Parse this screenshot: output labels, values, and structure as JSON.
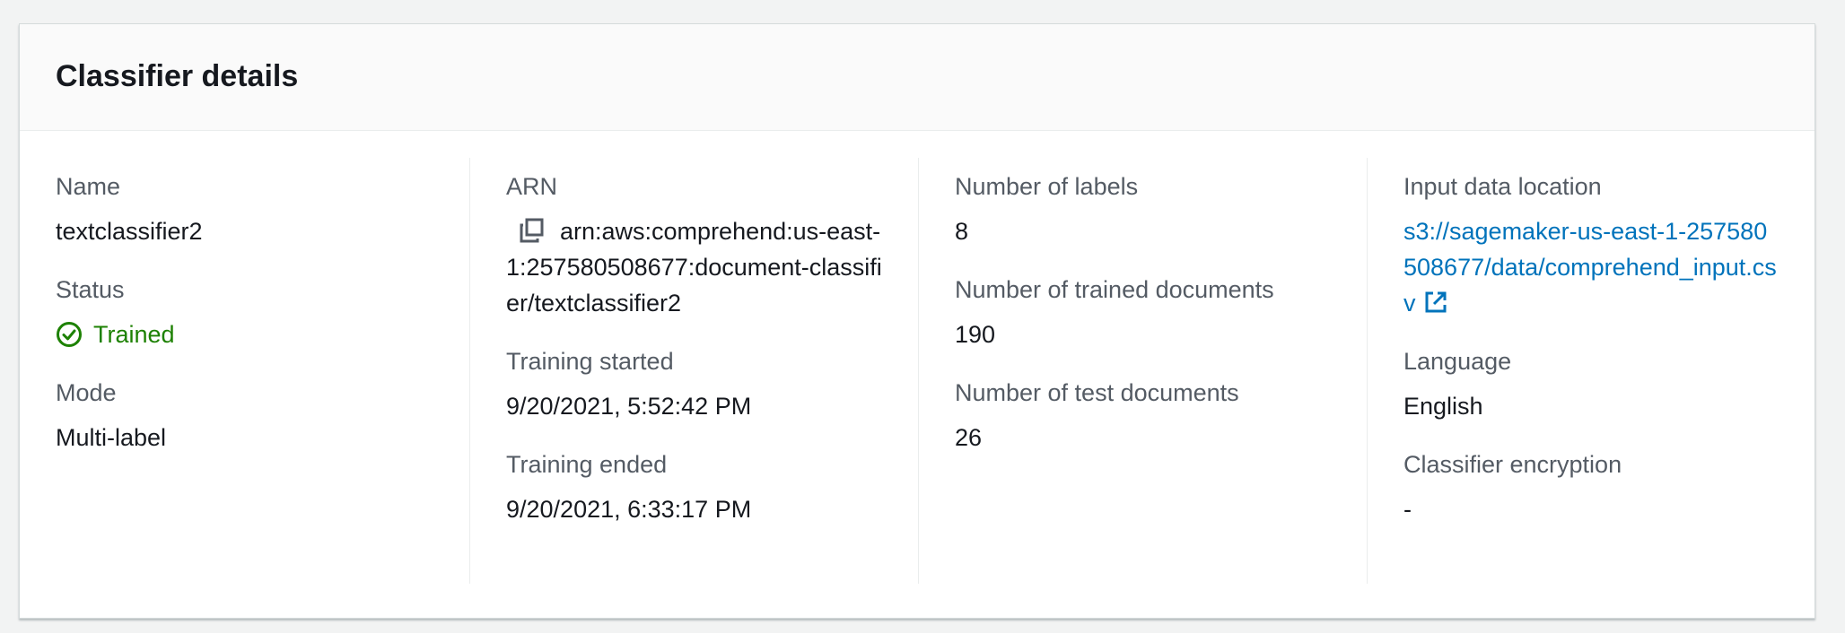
{
  "panel": {
    "title": "Classifier details"
  },
  "name": {
    "label": "Name",
    "value": "textclassifier2"
  },
  "status": {
    "label": "Status",
    "value": "Trained",
    "color": "#1d8102"
  },
  "mode": {
    "label": "Mode",
    "value": "Multi-label"
  },
  "arn": {
    "label": "ARN",
    "value": "arn:aws:comprehend:us-east-1:257580508677:document-classifier/textclassifier2"
  },
  "training_started": {
    "label": "Training started",
    "value": "9/20/2021, 5:52:42 PM"
  },
  "training_ended": {
    "label": "Training ended",
    "value": "9/20/2021, 6:33:17 PM"
  },
  "num_labels": {
    "label": "Number of labels",
    "value": "8"
  },
  "num_trained_docs": {
    "label": "Number of trained documents",
    "value": "190"
  },
  "num_test_docs": {
    "label": "Number of test documents",
    "value": "26"
  },
  "input_data_location": {
    "label": "Input data location",
    "value": "s3://sagemaker-us-east-1-257580508677/data/comprehend_input.csv",
    "link_color": "#0073bb"
  },
  "language": {
    "label": "Language",
    "value": "English"
  },
  "encryption": {
    "label": "Classifier encryption",
    "value": "-"
  },
  "icons": {
    "status": "status-success-icon",
    "copy": "copy-icon",
    "external": "external-link-icon"
  }
}
